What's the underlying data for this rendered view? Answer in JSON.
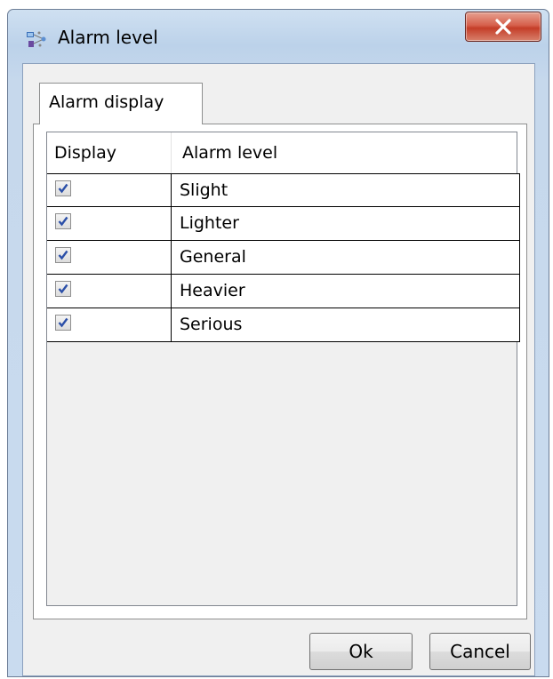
{
  "window": {
    "title": "Alarm level"
  },
  "tabs": [
    {
      "label": "Alarm display"
    }
  ],
  "grid": {
    "columns": [
      "Display",
      "Alarm level"
    ],
    "rows": [
      {
        "display": true,
        "level": "Slight"
      },
      {
        "display": true,
        "level": "Lighter"
      },
      {
        "display": true,
        "level": "General"
      },
      {
        "display": true,
        "level": "Heavier"
      },
      {
        "display": true,
        "level": "Serious"
      }
    ]
  },
  "buttons": {
    "ok": "Ok",
    "cancel": "Cancel"
  },
  "icons": {
    "app": "network-app-icon",
    "close": "close-icon",
    "check": "checkmark-icon"
  },
  "colors": {
    "close_button": "#c43d28",
    "checkmark": "#2b4fa8"
  }
}
